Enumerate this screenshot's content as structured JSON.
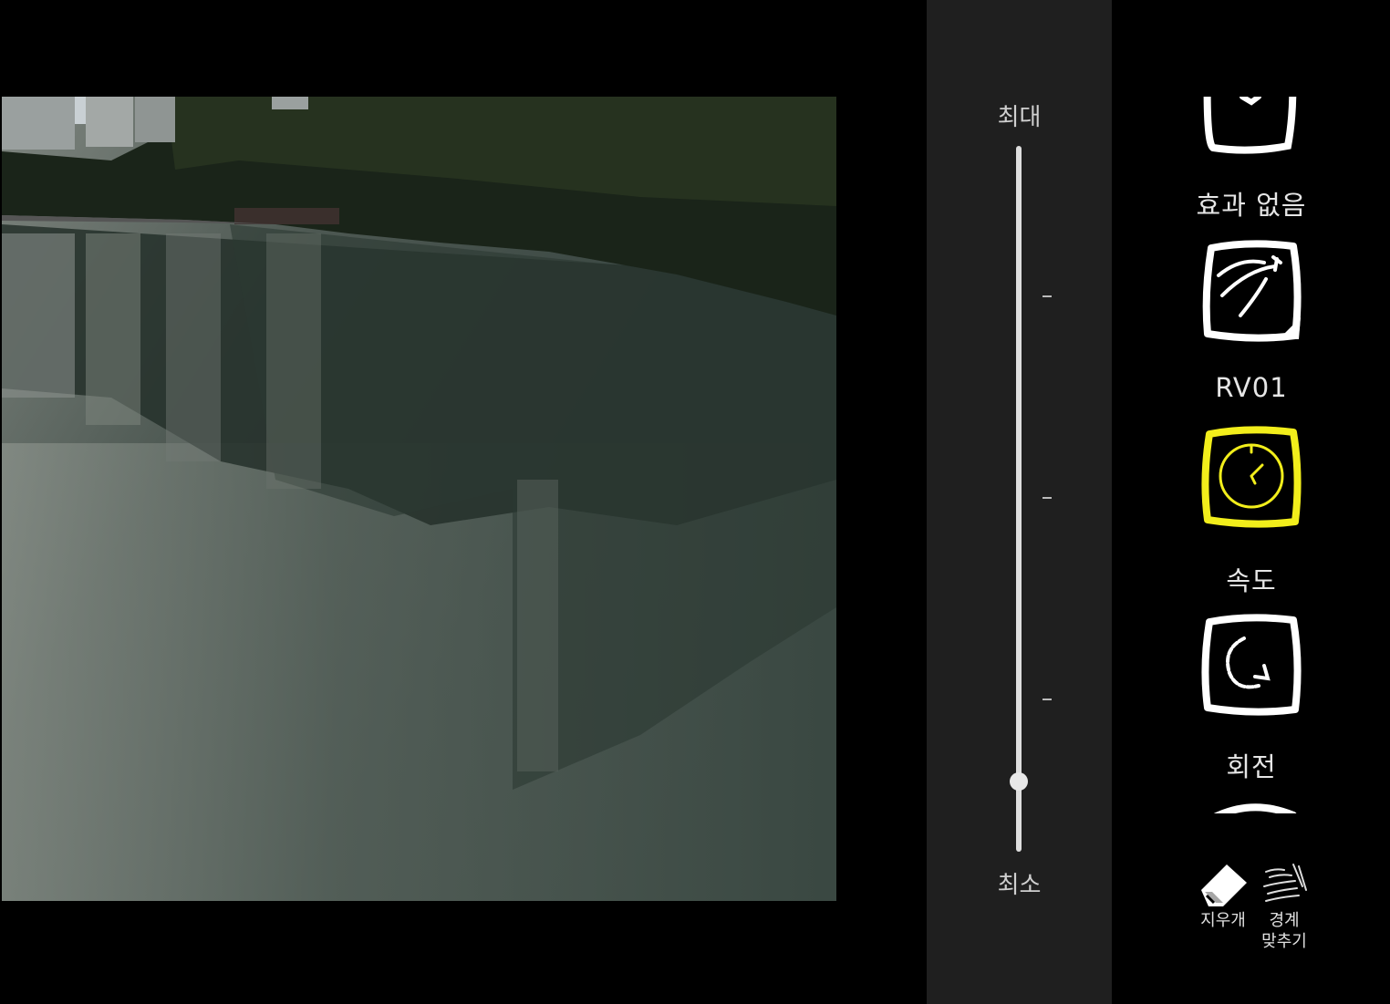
{
  "slider": {
    "max_label": "최대",
    "min_label": "최소",
    "level": 0.1
  },
  "effects": [
    {
      "label": "효과 없음",
      "icon": "no-effect-icon",
      "selected": false
    },
    {
      "label": "RV01",
      "icon": "rv01-effect-icon",
      "selected": false
    },
    {
      "label": "속도",
      "icon": "speed-icon",
      "selected": true
    },
    {
      "label": "회전",
      "icon": "rotate-icon",
      "selected": false
    }
  ],
  "tools": {
    "eraser_label": "지우개",
    "edge_fit_label_line1": "경계",
    "edge_fit_label_line2": "맞추기"
  },
  "colors": {
    "selected_accent": "#f2ee1b",
    "panel_bg": "#1f1f1f",
    "background": "#000000"
  }
}
